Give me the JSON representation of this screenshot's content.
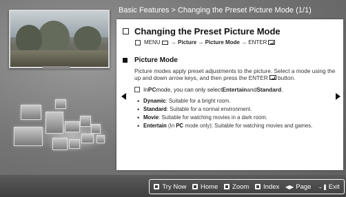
{
  "header": {
    "breadcrumb": "Basic Features > Changing the Preset Picture Mode (1/1)"
  },
  "card": {
    "title": "Changing the Preset Picture Mode",
    "menu_path": {
      "menu": "MENU",
      "steps": [
        "Picture",
        "Picture Mode"
      ],
      "end": "ENTER"
    },
    "section_title": "Picture Mode",
    "description": "Picture modes apply preset adjustments to the picture. Select a mode using the up and down arrow keys, and then press the ENTER",
    "description_suffix": " button.",
    "note": {
      "prefix": "In ",
      "pc": "PC",
      "middle": " mode, you can only select ",
      "entertain": "Entertain",
      "and": " and ",
      "standard": "Standard",
      "suffix": "."
    },
    "bullets": [
      {
        "term": "Dynamic",
        "text": ": Suitable for a bright room."
      },
      {
        "term": "Standard",
        "text": ": Suitable for a normal environment."
      },
      {
        "term": "Movie",
        "text": ": Suitable for watching movies in a dark room."
      },
      {
        "term": "Entertain",
        "text": " (In ",
        "pc": "PC",
        "text2": " mode only): Suitable for watching movies and games."
      }
    ]
  },
  "bottom_bar": {
    "try_now": "Try Now",
    "home": "Home",
    "zoom": "Zoom",
    "index": "Index",
    "page": "Page",
    "exit": "Exit"
  },
  "icons": {
    "left_arrow": "left-arrow-icon",
    "right_arrow": "right-arrow-icon"
  },
  "colors": {
    "background": "#6b6b6b",
    "card": "#ffffff",
    "bottom_bar": "#3f3f3f",
    "header_text": "#ffffff"
  }
}
